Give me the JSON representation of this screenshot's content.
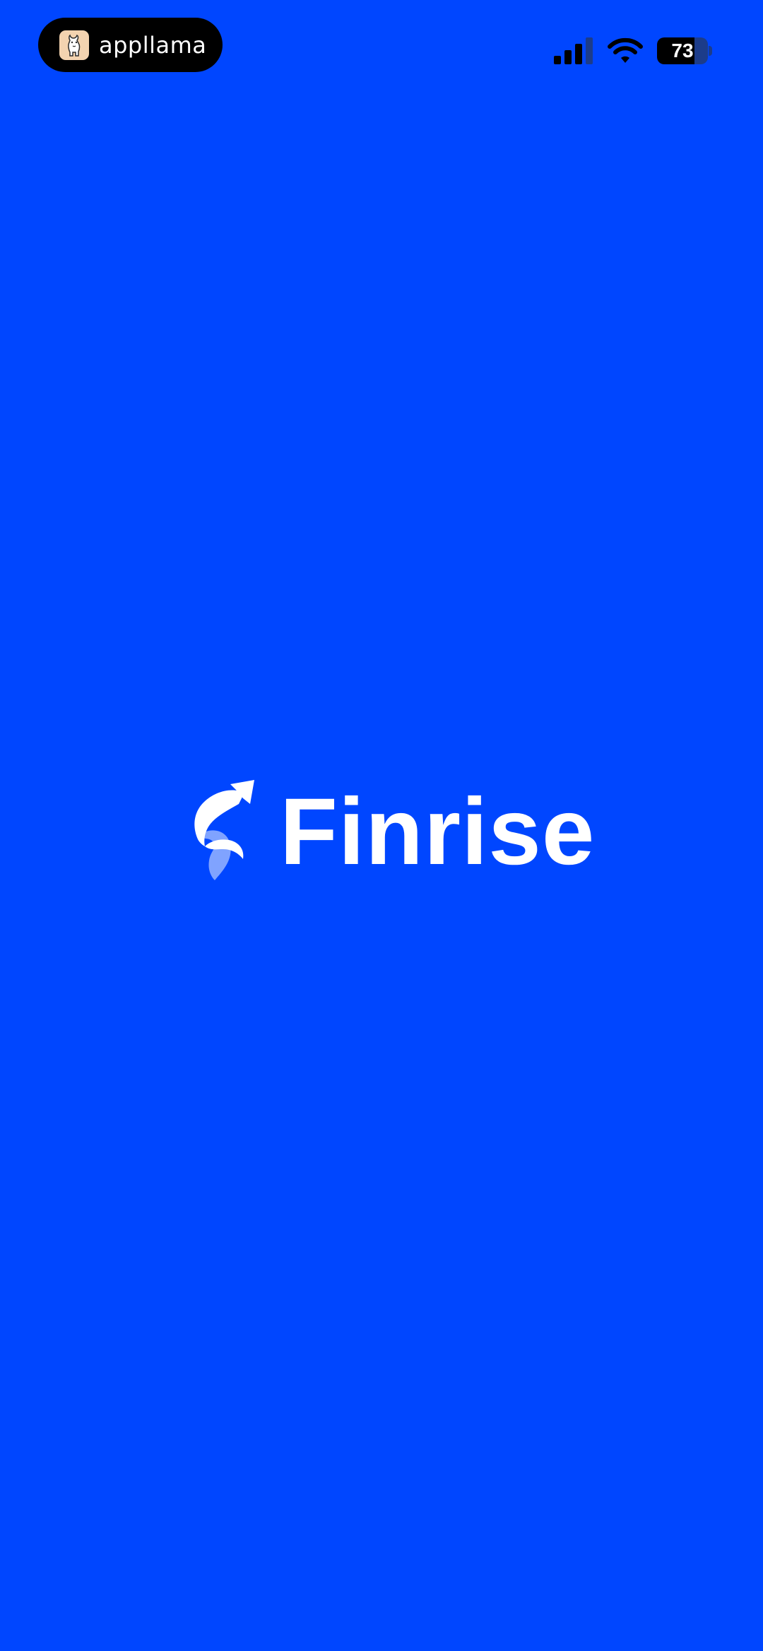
{
  "status_bar": {
    "app_pill": {
      "label": "appllama",
      "icon": "llama-icon"
    },
    "battery_percent": 73,
    "battery_label": "73",
    "icons": [
      "cellular-signal-icon",
      "wifi-icon",
      "battery-icon"
    ]
  },
  "splash": {
    "brand_name": "Finrise",
    "logo_icon": "finrise-logo-icon"
  },
  "colors": {
    "background": "#0046FF",
    "text": "#FFFFFF",
    "pill": "#000000"
  }
}
